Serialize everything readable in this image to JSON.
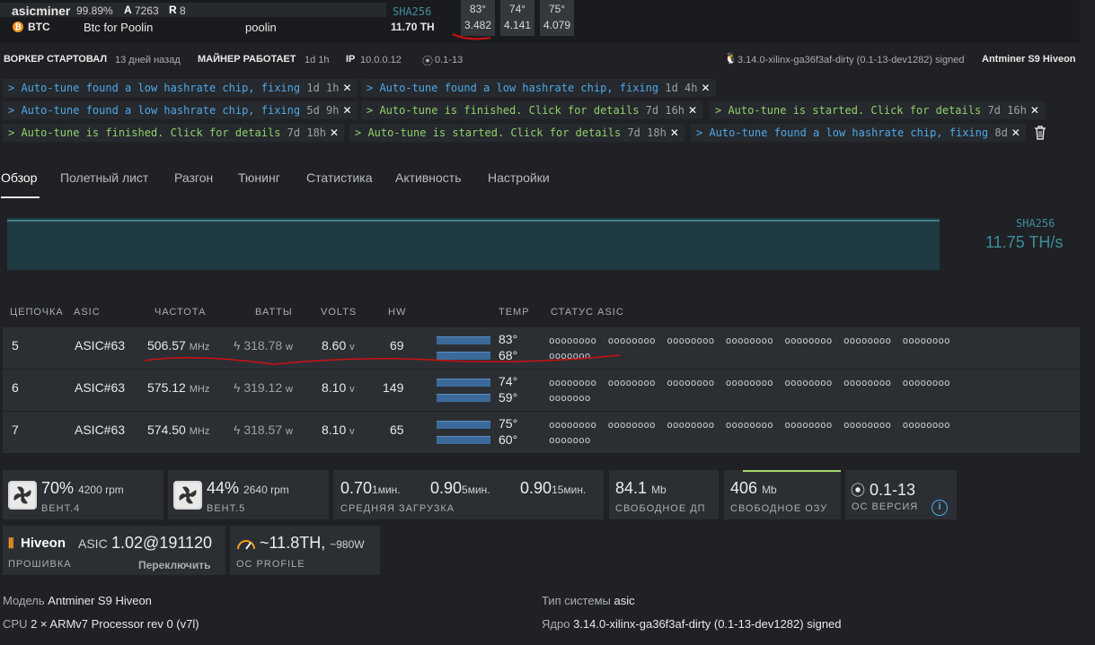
{
  "header": {
    "worker_name": "asicminer",
    "percent": "99.89%",
    "a_label": "A",
    "a_value": "7263",
    "r_label": "R",
    "r_value": "8",
    "coin": "BTC",
    "wallet": "Btc for Poolin",
    "pool": "poolin",
    "hashrate": "11.70 TH",
    "algo": "SHA256",
    "temps": [
      {
        "top": "83°",
        "bottom": "3.482"
      },
      {
        "top": "74°",
        "bottom": "4.141"
      },
      {
        "top": "75°",
        "bottom": "4.079"
      }
    ]
  },
  "status_line": {
    "worker_started_label": "ВОРКЕР СТАРТОВАЛ",
    "worker_started_value": "13 дней назад",
    "miner_running_label": "МАЙНЕР РАБОТАЕТ",
    "miner_running_value": "1d 1h",
    "ip_label": "IP",
    "ip_value": "10.0.0.12",
    "version": "0.1-13",
    "kernel": "3.14.0-xilinx-ga36f3af-dirty (0.1-13-dev1282) signed",
    "model": "Antminer S9 Hiveon"
  },
  "messages": [
    {
      "text": "> Auto-tune found a low hashrate chip, fixing",
      "time": "1d 1h",
      "color": "blue"
    },
    {
      "text": "> Auto-tune found a low hashrate chip, fixing",
      "time": "1d 4h",
      "color": "blue"
    },
    {
      "text": "> Auto-tune found a low hashrate chip, fixing",
      "time": "5d 9h",
      "color": "blue"
    },
    {
      "text": "> Auto-tune is finished. Click for details",
      "time": "7d 16h",
      "color": "green"
    },
    {
      "text": "> Auto-tune is started. Click for details",
      "time": "7d 16h",
      "color": "green"
    },
    {
      "text": "> Auto-tune is finished. Click for details",
      "time": "7d 18h",
      "color": "green"
    },
    {
      "text": "> Auto-tune is started. Click for details",
      "time": "7d 18h",
      "color": "green"
    },
    {
      "text": "> Auto-tune found a low hashrate chip, fixing",
      "time": "8d",
      "color": "blue"
    }
  ],
  "tabs": [
    "Обзор",
    "Полетный лист",
    "Разгон",
    "Тюнинг",
    "Статистика",
    "Активность",
    "Настройки"
  ],
  "chart": {
    "algo": "SHA256",
    "hashrate": "11.75 TH/s"
  },
  "table": {
    "headers": [
      "ЦЕПОЧКА",
      "ASIC",
      "ЧАСТОТА",
      "ВАТТЫ",
      "VOLTS",
      "HW",
      "TEMP",
      "СТАТУС ASIC"
    ],
    "rows": [
      {
        "chain": "5",
        "asic": "ASIC#63",
        "freq": "506.57",
        "freq_unit": "MHz",
        "watts": "318.78",
        "watts_unit": "w",
        "volts": "8.60",
        "volts_unit": "v",
        "hw": "69",
        "temp1": "83°",
        "temp2": "68°",
        "status_line1": "oooooooo oooooooo oooooooo oooooooo oooooooo oooooooo oooooooo",
        "status_line2": "ooooooo"
      },
      {
        "chain": "6",
        "asic": "ASIC#63",
        "freq": "575.12",
        "freq_unit": "MHz",
        "watts": "319.12",
        "watts_unit": "w",
        "volts": "8.10",
        "volts_unit": "v",
        "hw": "149",
        "temp1": "74°",
        "temp2": "59°",
        "status_line1": "oooooooo oooooooo oooooooo oooooooo oooooooo oooooooo oooooooo",
        "status_line2": "ooooooo"
      },
      {
        "chain": "7",
        "asic": "ASIC#63",
        "freq": "574.50",
        "freq_unit": "MHz",
        "watts": "318.57",
        "watts_unit": "w",
        "volts": "8.10",
        "volts_unit": "v",
        "hw": "65",
        "temp1": "75°",
        "temp2": "60°",
        "status_line1": "oooooooo oooooooo oooooooo oooooooo oooooooo oooooooo oooooooo",
        "status_line2": "ooooooo"
      }
    ]
  },
  "cards": {
    "fan4": {
      "pct": "70%",
      "rpm": "4200 rpm",
      "label": "ВЕНТ.4"
    },
    "fan5": {
      "pct": "44%",
      "rpm": "2640 rpm",
      "label": "ВЕНТ.5"
    },
    "load": {
      "v1": "0.70",
      "u1": "1мин.",
      "v5": "0.90",
      "u5": "5мин.",
      "v15": "0.90",
      "u15": "15мин.",
      "label": "СРЕДНЯЯ ЗАГРУЗКА"
    },
    "disk": {
      "value": "84.1",
      "unit": "Mb",
      "label": "СВОБОДНОЕ ДП"
    },
    "ram": {
      "value": "406",
      "unit": "Mb",
      "label": "СВОБОДНОЕ ОЗУ"
    },
    "os": {
      "value": "0.1-13",
      "label": "ОС ВЕРСИЯ",
      "info": "i"
    },
    "firmware": {
      "brand": "Hiveon",
      "asic": "ASIC",
      "version": "1.02@191120",
      "label": "ПРОШИВКА",
      "switch": "Переключить"
    },
    "oc": {
      "value": "~11.8TH,",
      "watts": "~980W",
      "label": "OC PROFILE"
    }
  },
  "info": {
    "model_label": "Модель",
    "model_value": "Antminer S9 Hiveon",
    "cpu_label": "CPU",
    "cpu_value": "2 × ARMv7 Processor rev 0 (v7l)",
    "system_label": "Тип системы",
    "system_value": "asic",
    "kernel_label": "Ядро",
    "kernel_value": "3.14.0-xilinx-ga36f3af-dirty (0.1-13-dev1282) signed"
  },
  "colors": {
    "accent_blue": "#4fa8e8",
    "accent_green": "#8fd16b",
    "annotation_red": "#d01010"
  }
}
